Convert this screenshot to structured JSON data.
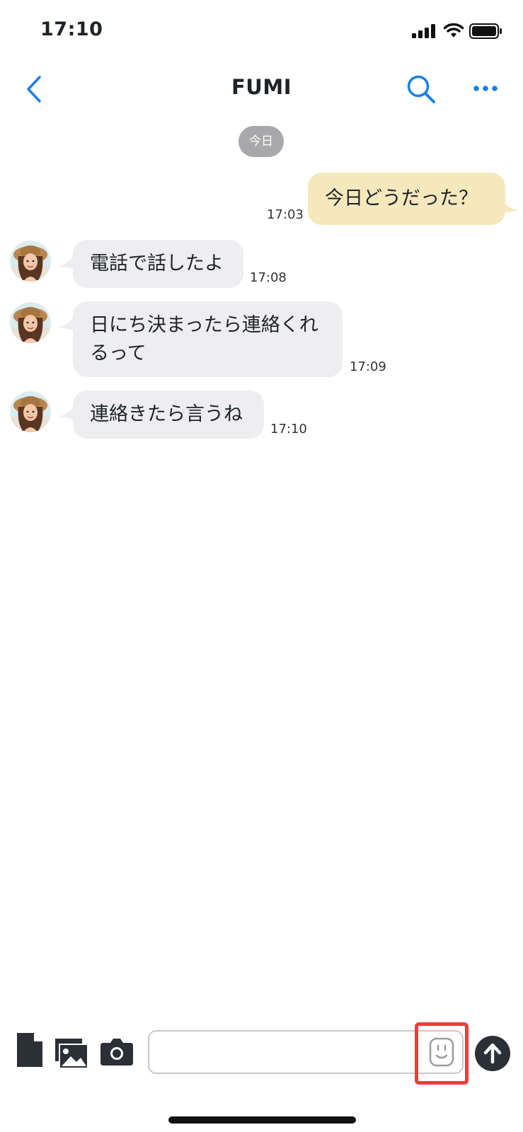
{
  "status_bar": {
    "time": "17:10"
  },
  "header": {
    "title": "FUMI"
  },
  "date_chip": "今日",
  "messages": [
    {
      "direction": "out",
      "text": "今日どうだった？",
      "time": "17:03"
    },
    {
      "direction": "in",
      "text": "電話で話したよ",
      "time": "17:08"
    },
    {
      "direction": "in",
      "text_line1": "日にち決まったら連絡くれ",
      "text_line2": "るって",
      "time": "17:09"
    },
    {
      "direction": "in",
      "text": "連絡きたら言うね",
      "time": "17:10"
    }
  ],
  "composer": {
    "placeholder": ""
  },
  "icons": {
    "back": "chevron-left-icon",
    "search": "search-icon",
    "more": "more-icon",
    "file": "file-icon",
    "image": "image-icon",
    "camera": "camera-icon",
    "emoji": "emoji-icon",
    "send": "arrow-up-icon"
  },
  "colors": {
    "accent": "#1a7fe6",
    "outgoing_bubble": "#f5e8bd",
    "incoming_bubble": "#eeeef0",
    "date_chip": "#a8a8aa",
    "highlight": "#ef3b3b"
  }
}
